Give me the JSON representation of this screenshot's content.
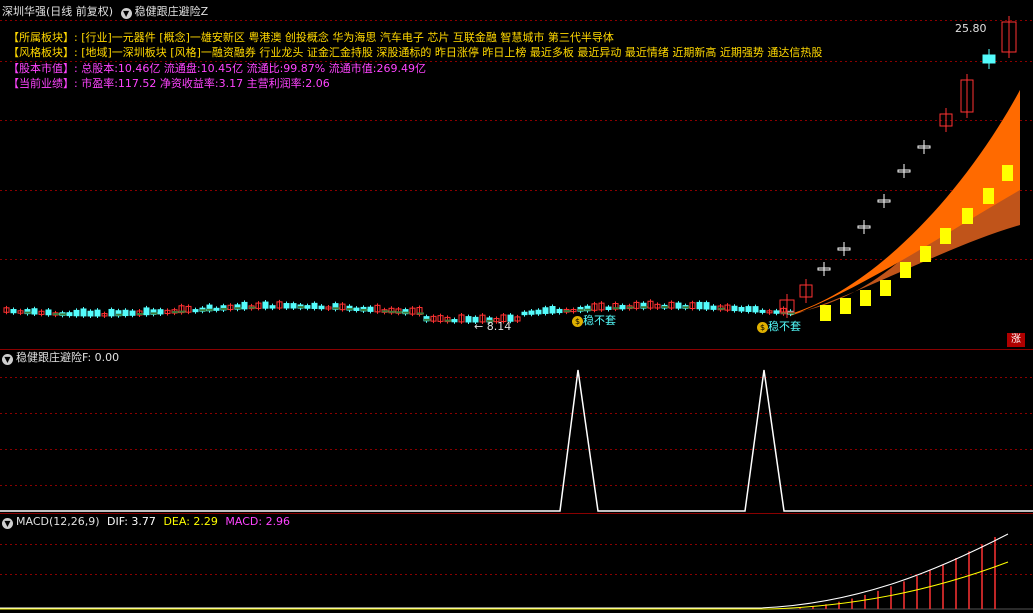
{
  "main_header": {
    "title": "深圳华强(日线 前复权)",
    "indicator": "稳健跟庄避险Z"
  },
  "info_lines": [
    {
      "label": "【所属板块】:",
      "text": "[行业]一元器件 [概念]一雄安新区 粤港澳 创投概念 华为海思 汽车电子 芯片 互联金融 智慧城市 第三代半导体",
      "color": "#ffd800"
    },
    {
      "label": "【风格板块】:",
      "text": "[地域]一深圳板块 [风格]一融资融券 行业龙头 证金汇金持股 深股通标的 昨日涨停 昨日上榜 最近多板 最近异动 最近情绪 近期新高 近期强势 通达信热股",
      "color": "#ffd800"
    },
    {
      "label": "【股本市值】:",
      "text": "总股本:10.46亿 流通盘:10.45亿 流通比:99.87% 流通市值:269.49亿",
      "color": "#ff44ff"
    },
    {
      "label": "【当前业绩】:",
      "text": "市盈率:117.52 净资收益率:3.17 主营利润率:2.06",
      "color": "#ff44ff"
    }
  ],
  "price_labels": {
    "high": "25.80",
    "low": "8.14",
    "signal_1": "稳不套",
    "signal_2": "稳不套"
  },
  "badge": "涨",
  "sub1_header": {
    "indicator": "稳健跟庄避险F",
    "value": ": 0.00"
  },
  "macd_header": {
    "name": "MACD(12,26,9)",
    "dif_label": "DIF: 3.77",
    "dea_label": "DEA: 2.29",
    "macd_label": "MACD: 2.96"
  },
  "colors": {
    "up": "#ff3232",
    "down": "#54fcfc",
    "band": "#ff6a00",
    "band_dark": "#c0541a",
    "yellow_marker": "#ffff00",
    "grid": "#8a0000"
  }
}
